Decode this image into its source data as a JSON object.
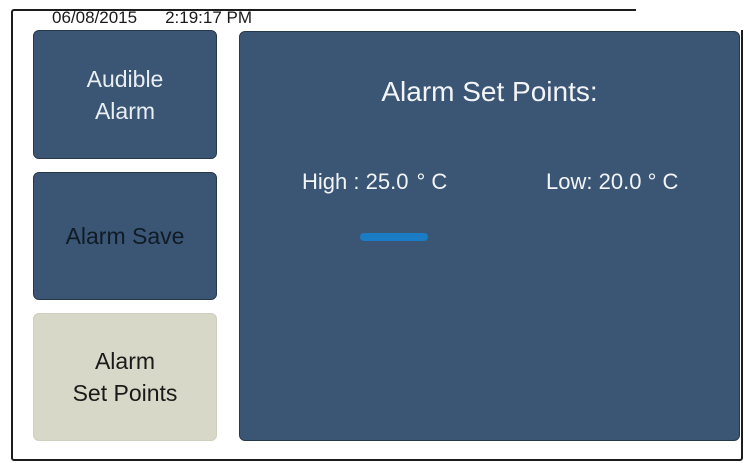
{
  "status": {
    "date": "06/08/2015",
    "time": "2:19:17 PM"
  },
  "sidebar": {
    "items": [
      {
        "label": "Audible\nAlarm",
        "active": false
      },
      {
        "label": "Alarm Save",
        "active": false
      },
      {
        "label": "Alarm\nSet Points",
        "active": true
      }
    ]
  },
  "panel": {
    "title": "Alarm Set Points:",
    "high": {
      "label": "High :",
      "value": "25.0",
      "unit": "° C"
    },
    "low": {
      "label": "Low:",
      "value": "20.0",
      "unit": "° C"
    }
  },
  "colors": {
    "panel_bg": "#3b5674",
    "active_button_bg": "#d8d8c8",
    "cursor": "#1a7cc4"
  }
}
